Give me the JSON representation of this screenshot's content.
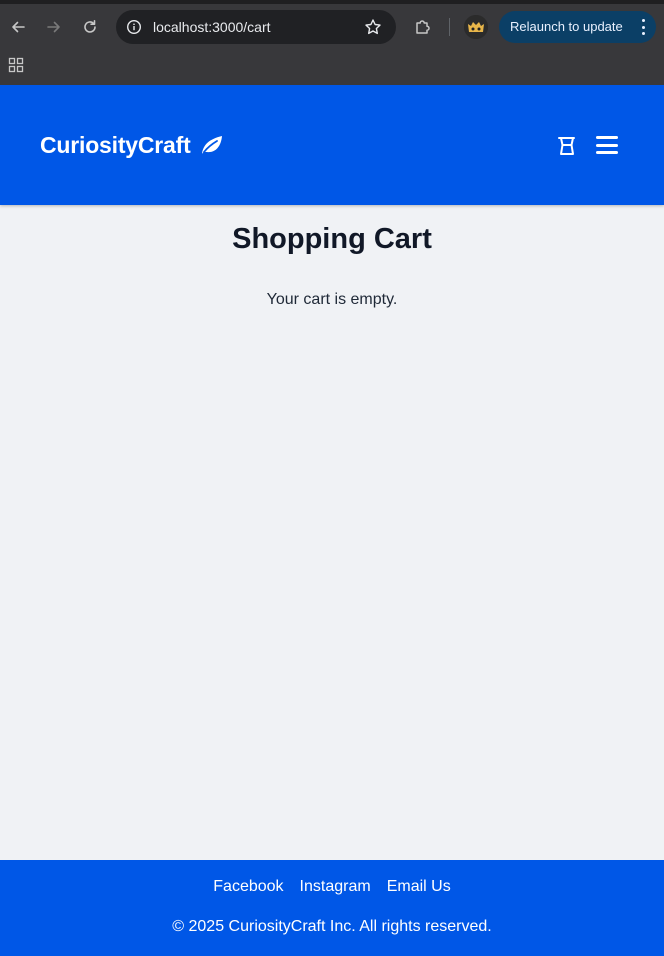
{
  "browser": {
    "url": "localhost:3000/cart",
    "relaunch_label": "Relaunch to update",
    "icons": [
      "back-arrow-icon",
      "forward-arrow-icon",
      "reload-icon",
      "site-info-icon",
      "bookmark-star-icon",
      "extensions-puzzle-icon",
      "more-vert-icon",
      "apps-grid-icon"
    ]
  },
  "header": {
    "brand": "CuriosityCraft",
    "brand_icon": "leaf-icon",
    "cart_icon": "shopping-cart-icon",
    "menu_icon": "hamburger-menu-icon",
    "background": "#0057e7"
  },
  "main": {
    "title": "Shopping Cart",
    "empty_message": "Your cart is empty.",
    "background": "#f0f2f5"
  },
  "footer": {
    "links": [
      "Facebook",
      "Instagram",
      "Email Us"
    ],
    "copyright": "© 2025 CuriosityCraft Inc. All rights reserved.",
    "background": "#0057e7"
  }
}
